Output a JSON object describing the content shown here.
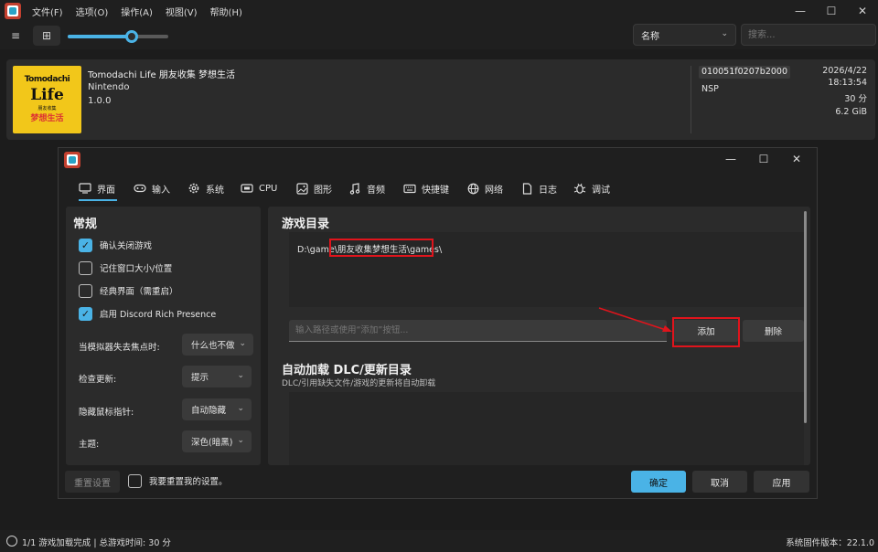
{
  "menu": [
    "文件(F)",
    "选项(O)",
    "操作(A)",
    "视图(V)",
    "帮助(H)"
  ],
  "toolbar": {
    "list_icon": "≡",
    "grid_icon": "⊞",
    "zoom_slider_value": 0.64,
    "sort_value": "名称",
    "search_placeholder": "搜索..."
  },
  "game": {
    "title": "Tomodachi Life 朋友收集 梦想生活",
    "publisher": "Nintendo",
    "version": "1.0.0",
    "title_id": "010051f0207b2000",
    "format": "NSP",
    "last_played_date": "2026/4/22",
    "last_played_time": "18:13:54",
    "play_time": "30 分",
    "size": "6.2 GiB",
    "cover": {
      "line1": "Tomodachi",
      "line2": "Life",
      "line3": "朋友收集",
      "line4": "梦想生活"
    }
  },
  "dialog": {
    "tabs": [
      {
        "label": "界面",
        "icon": "monitor-icon"
      },
      {
        "label": "输入",
        "icon": "gamepad-icon"
      },
      {
        "label": "系统",
        "icon": "gear-icon"
      },
      {
        "label": "CPU",
        "icon": "cpu-icon"
      },
      {
        "label": "图形",
        "icon": "image-icon"
      },
      {
        "label": "音频",
        "icon": "music-icon"
      },
      {
        "label": "快捷键",
        "icon": "keyboard-icon"
      },
      {
        "label": "网络",
        "icon": "globe-icon"
      },
      {
        "label": "日志",
        "icon": "document-icon"
      },
      {
        "label": "调试",
        "icon": "bug-icon"
      }
    ],
    "general": {
      "heading": "常规",
      "checkboxes": [
        {
          "label": "确认关闭游戏",
          "checked": true
        },
        {
          "label": "记住窗口大小/位置",
          "checked": false
        },
        {
          "label": "经典界面（需重启）",
          "checked": false
        },
        {
          "label": "启用 Discord Rich Presence",
          "checked": true
        }
      ],
      "options": [
        {
          "label": "当模拟器失去焦点时:",
          "value": "什么也不做"
        },
        {
          "label": "检查更新:",
          "value": "提示"
        },
        {
          "label": "隐藏鼠标指针:",
          "value": "自动隐藏"
        },
        {
          "label": "主题:",
          "value": "深色(暗黑)"
        }
      ]
    },
    "game_dirs": {
      "heading": "游戏目录",
      "paths": [
        "D:\\game\\朋友收集梦想生活\\games\\"
      ],
      "path_input_placeholder": "输入路径或使用“添加”按钮...",
      "add_label": "添加",
      "remove_label": "删除"
    },
    "dlc_dirs": {
      "heading": "自动加载 DLC/更新目录",
      "subtitle": "DLC/引用缺失文件/游戏的更新将自动卸载"
    },
    "footer": {
      "reset_label": "重置设置",
      "reset_confirm_label": "我要重置我的设置。",
      "ok_label": "确定",
      "cancel_label": "取消",
      "apply_label": "应用"
    }
  },
  "status": {
    "left": "1/1 游戏加载完成 | 总游戏时间: 30 分",
    "right": "系统固件版本：22.1.0"
  },
  "colors": {
    "accent": "#4ab3e6",
    "annotation": "#e0141c"
  }
}
